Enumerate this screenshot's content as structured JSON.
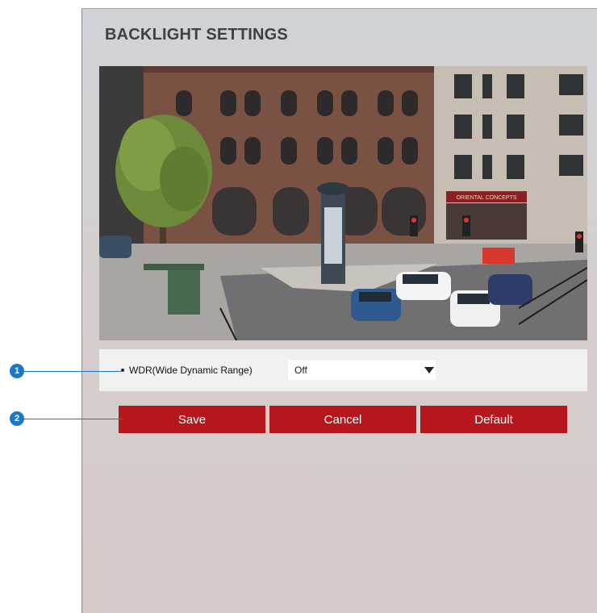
{
  "page": {
    "title": "BACKLIGHT SETTINGS"
  },
  "camera": {
    "sign_text": "ORIENTAL CONCEPTS"
  },
  "wdr": {
    "label": "WDR(Wide Dynamic Range)",
    "value": "Off"
  },
  "buttons": {
    "save": "Save",
    "cancel": "Cancel",
    "default": "Default"
  },
  "callouts": [
    "1",
    "2"
  ],
  "colors": {
    "accent_red": "#b5171c",
    "callout_blue": "#1b78c2"
  }
}
